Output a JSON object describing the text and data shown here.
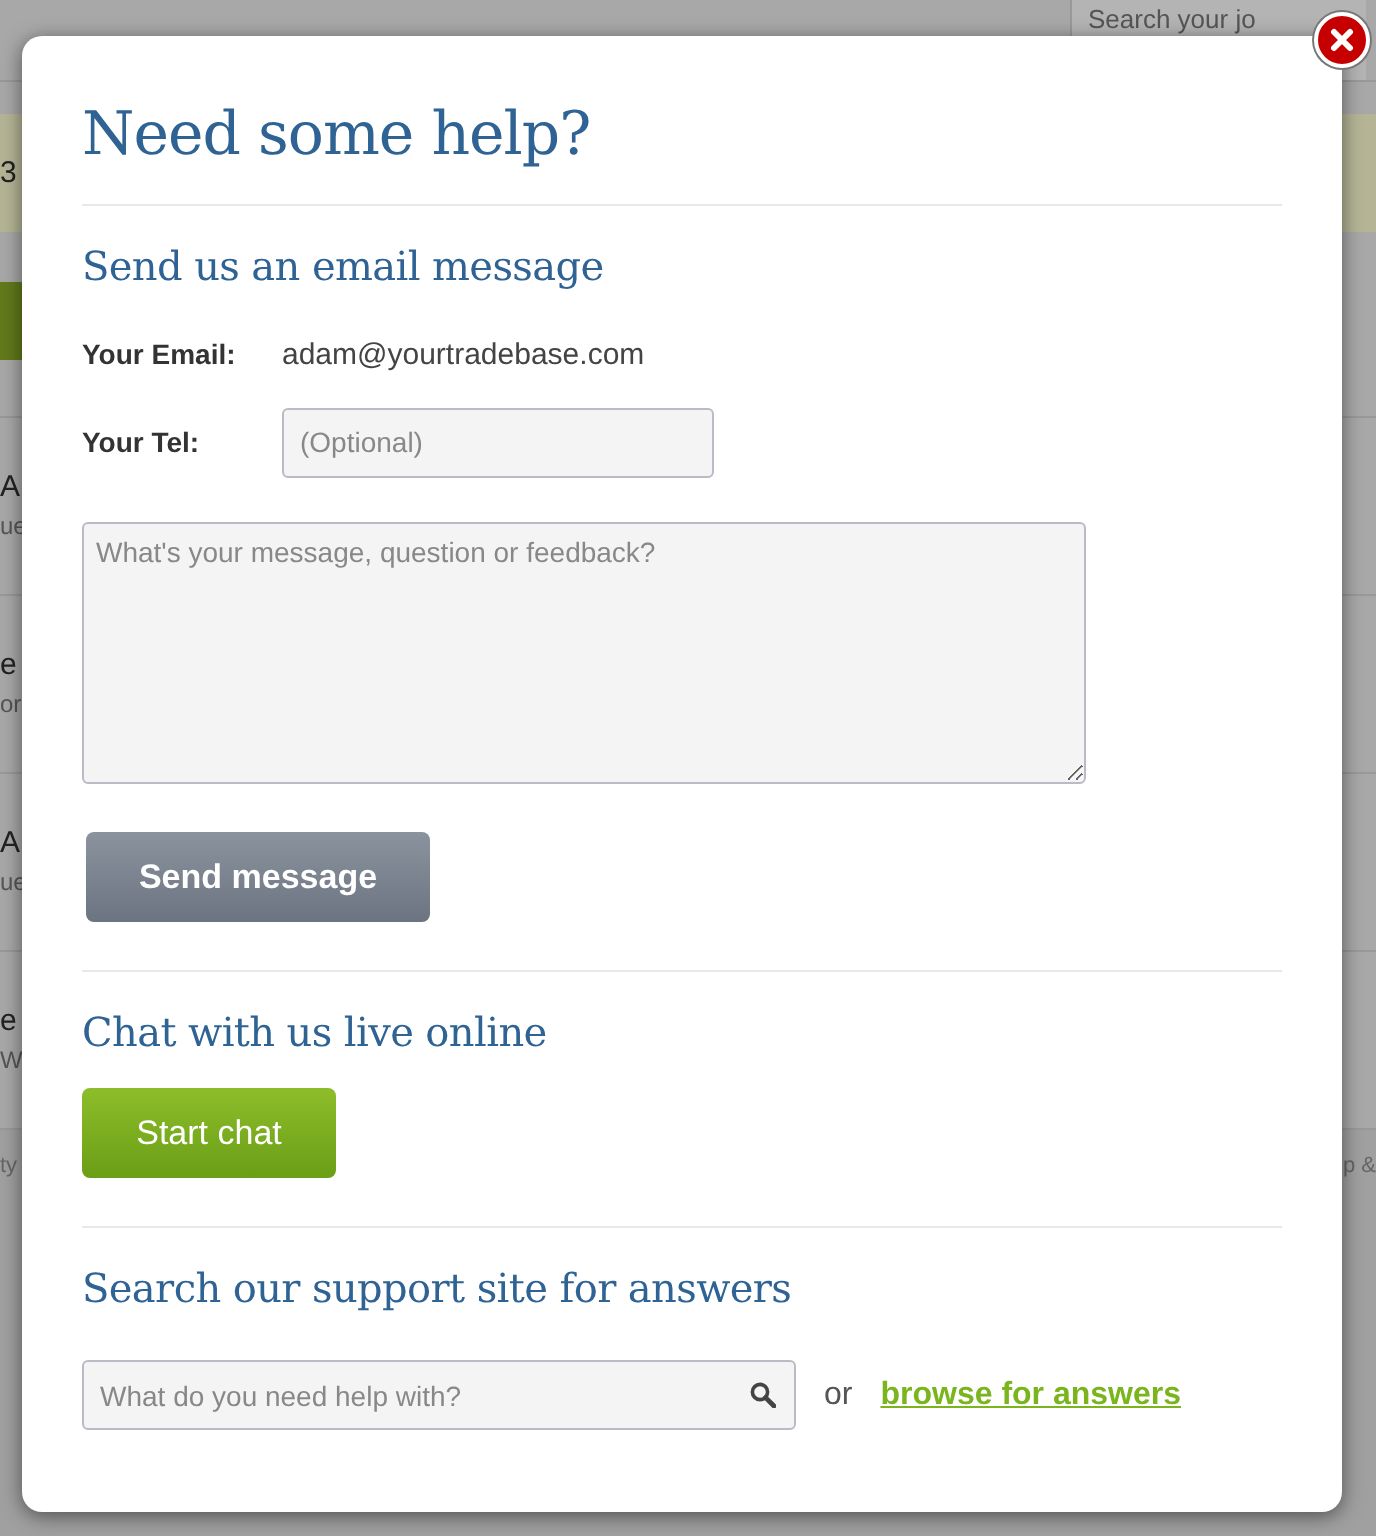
{
  "background": {
    "search": {
      "placeholder": "Search your jo"
    },
    "fragments": [
      "3",
      "A",
      "ue",
      "e",
      "or",
      "A",
      "ue",
      "e",
      "W",
      "ty"
    ],
    "footer_right": "p &"
  },
  "dialog": {
    "title": "Need some help?",
    "email_section": {
      "heading": "Send us an email message",
      "email_label": "Your Email:",
      "email_value": "adam@yourtradebase.com",
      "tel_label": "Your Tel:",
      "tel_placeholder": "(Optional)",
      "message_placeholder": "What's your message, question or feedback?",
      "button": "Send message"
    },
    "chat_section": {
      "heading": "Chat with us live online",
      "button": "Start chat"
    },
    "support_section": {
      "heading": "Search our support site for answers",
      "search_placeholder": "What do you need help with?",
      "or_text": "or",
      "link": "browse for answers"
    }
  }
}
